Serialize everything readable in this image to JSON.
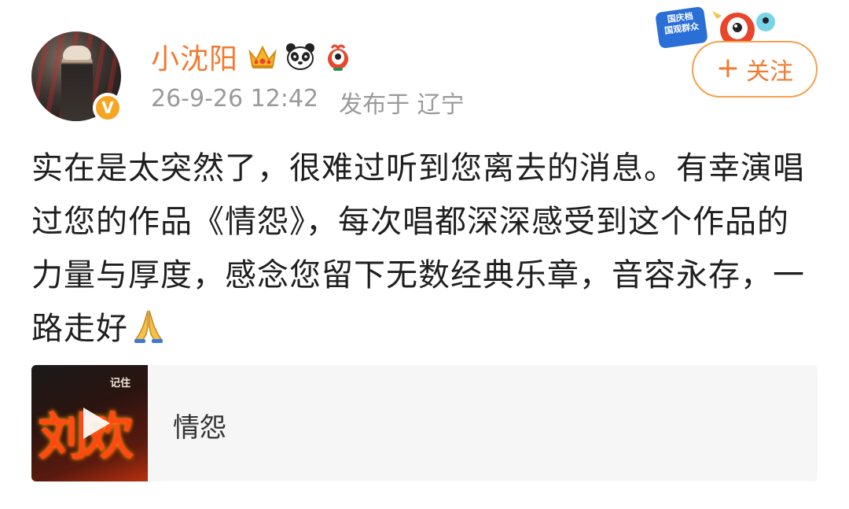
{
  "post": {
    "username": "小沈阳",
    "timestamp": "26-9-26 12:42",
    "location": "发布于 辽宁",
    "text": "实在是太突然了，很难过听到您离去的消息。有幸演唱过您的作品《情怨》，每次唱都深深感受到这个作品的力量与厚度，感念您留下无数经典乐章，音容永存，一路走好"
  },
  "badges": {
    "crown_icon": "crown-icon",
    "panda_icon": "panda-icon",
    "mascot_icon": "mascot-icon",
    "verified_icon": "verified-v-icon",
    "verified_letter": "V"
  },
  "banner": {
    "line1": "国庆档",
    "line2": "国观群众"
  },
  "follow_button": {
    "plus": "+",
    "label": "关注"
  },
  "music_card": {
    "cover_small_text": "记住",
    "cover_big_text": "刘欢",
    "title": "情怨"
  },
  "colors": {
    "username": "#f07a2f",
    "follow_border": "#f6a14a",
    "verified": "#f6a623",
    "meta_text": "#9a9a9a",
    "card_bg": "#f6f6f6"
  }
}
